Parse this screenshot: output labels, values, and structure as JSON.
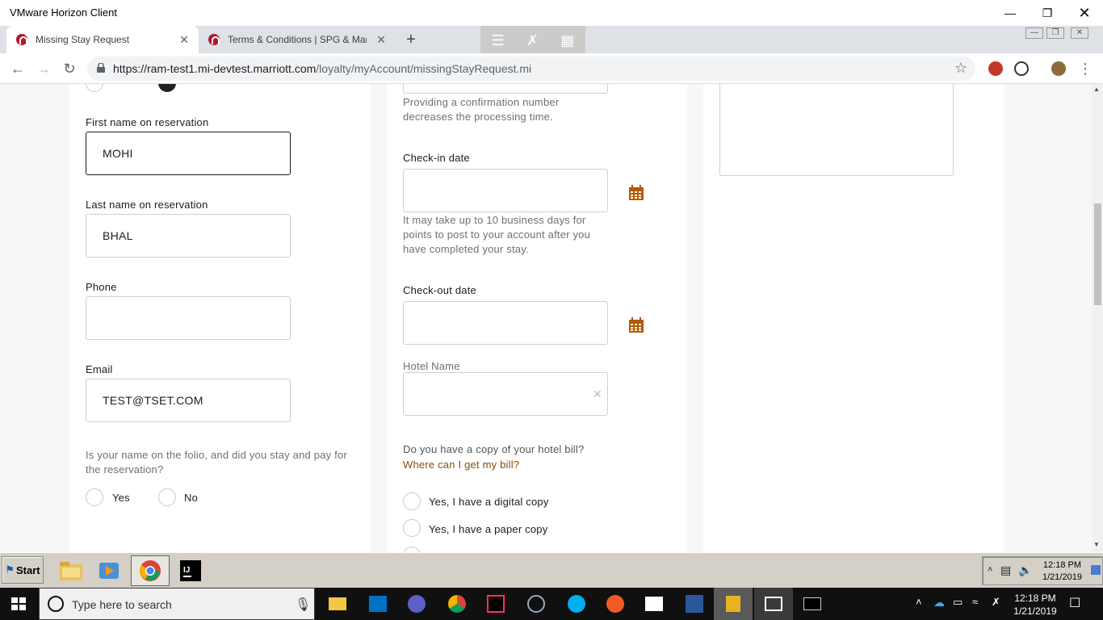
{
  "window": {
    "title": "VMware Horizon Client"
  },
  "tabs": [
    {
      "label": "Missing Stay Request",
      "active": true
    },
    {
      "label": "Terms & Conditions | SPG & Marriott",
      "active": false
    }
  ],
  "address": {
    "url_main": "https://ram-test1.mi-devtest.marriott.com",
    "url_path": "/loyalty/myAccount/missingStayRequest.mi"
  },
  "form_left": {
    "first_name_label": "First name on reservation",
    "first_name_value": "MOHI",
    "last_name_label": "Last name on reservation",
    "last_name_value": "BHAL",
    "phone_label": "Phone",
    "phone_value": "",
    "email_label": "Email",
    "email_value": "TEST@TSET.COM",
    "folio_question": "Is your name on the folio, and did you stay and pay for the reservation?",
    "yes_label": "Yes",
    "no_label": "No"
  },
  "form_middle": {
    "confirmation_help": "Providing a confirmation number decreases the processing time.",
    "checkin_label": "Check-in date",
    "checkin_help": "It may take up to 10 business days for points to post to your account after you have completed your stay.",
    "checkout_label": "Check-out date",
    "hotel_label": "Hotel Name",
    "bill_question": "Do you have a copy of your hotel bill?",
    "bill_link": "Where can I get my bill?",
    "bill_option_digital": "Yes, I have a digital copy",
    "bill_option_paper": "Yes, I have a paper copy"
  },
  "remote_taskbar": {
    "start_label": "Start",
    "time": "12:18 PM",
    "date": "1/21/2019"
  },
  "local_taskbar": {
    "search_placeholder": "Type here to search",
    "time": "12:18 PM",
    "date": "1/21/2019"
  },
  "colors": {
    "accent_brown": "#8c4a0f",
    "calendar_orange": "#b35a00",
    "marriott_red": "#b1182e"
  }
}
